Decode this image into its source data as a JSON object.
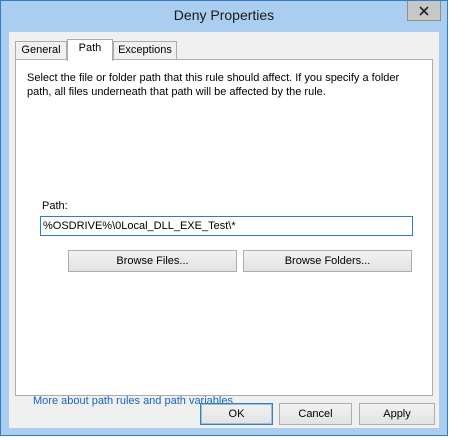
{
  "window": {
    "title": "Deny Properties",
    "close_glyph": "✕"
  },
  "tabs": [
    {
      "label": "General"
    },
    {
      "label": "Path",
      "active": true
    },
    {
      "label": "Exceptions"
    }
  ],
  "panel": {
    "description": "Select the file or folder path that this rule should affect. If you specify a folder path, all files underneath that path will be affected by the rule.",
    "path_label": "Path:",
    "path_value": "%OSDRIVE%\\0Local_DLL_EXE_Test\\*",
    "browse_files_label": "Browse Files...",
    "browse_folders_label": "Browse Folders..."
  },
  "link": {
    "more_info": "More about path rules and path variables"
  },
  "footer": {
    "ok_label": "OK",
    "cancel_label": "Cancel",
    "apply_label": "Apply"
  },
  "colors": {
    "window_border": "#2f7ec6",
    "frame": "#aacdf0",
    "link": "#1565c0",
    "input_focus": "#2c7ad6"
  },
  "icons": {
    "close": "close-icon"
  }
}
